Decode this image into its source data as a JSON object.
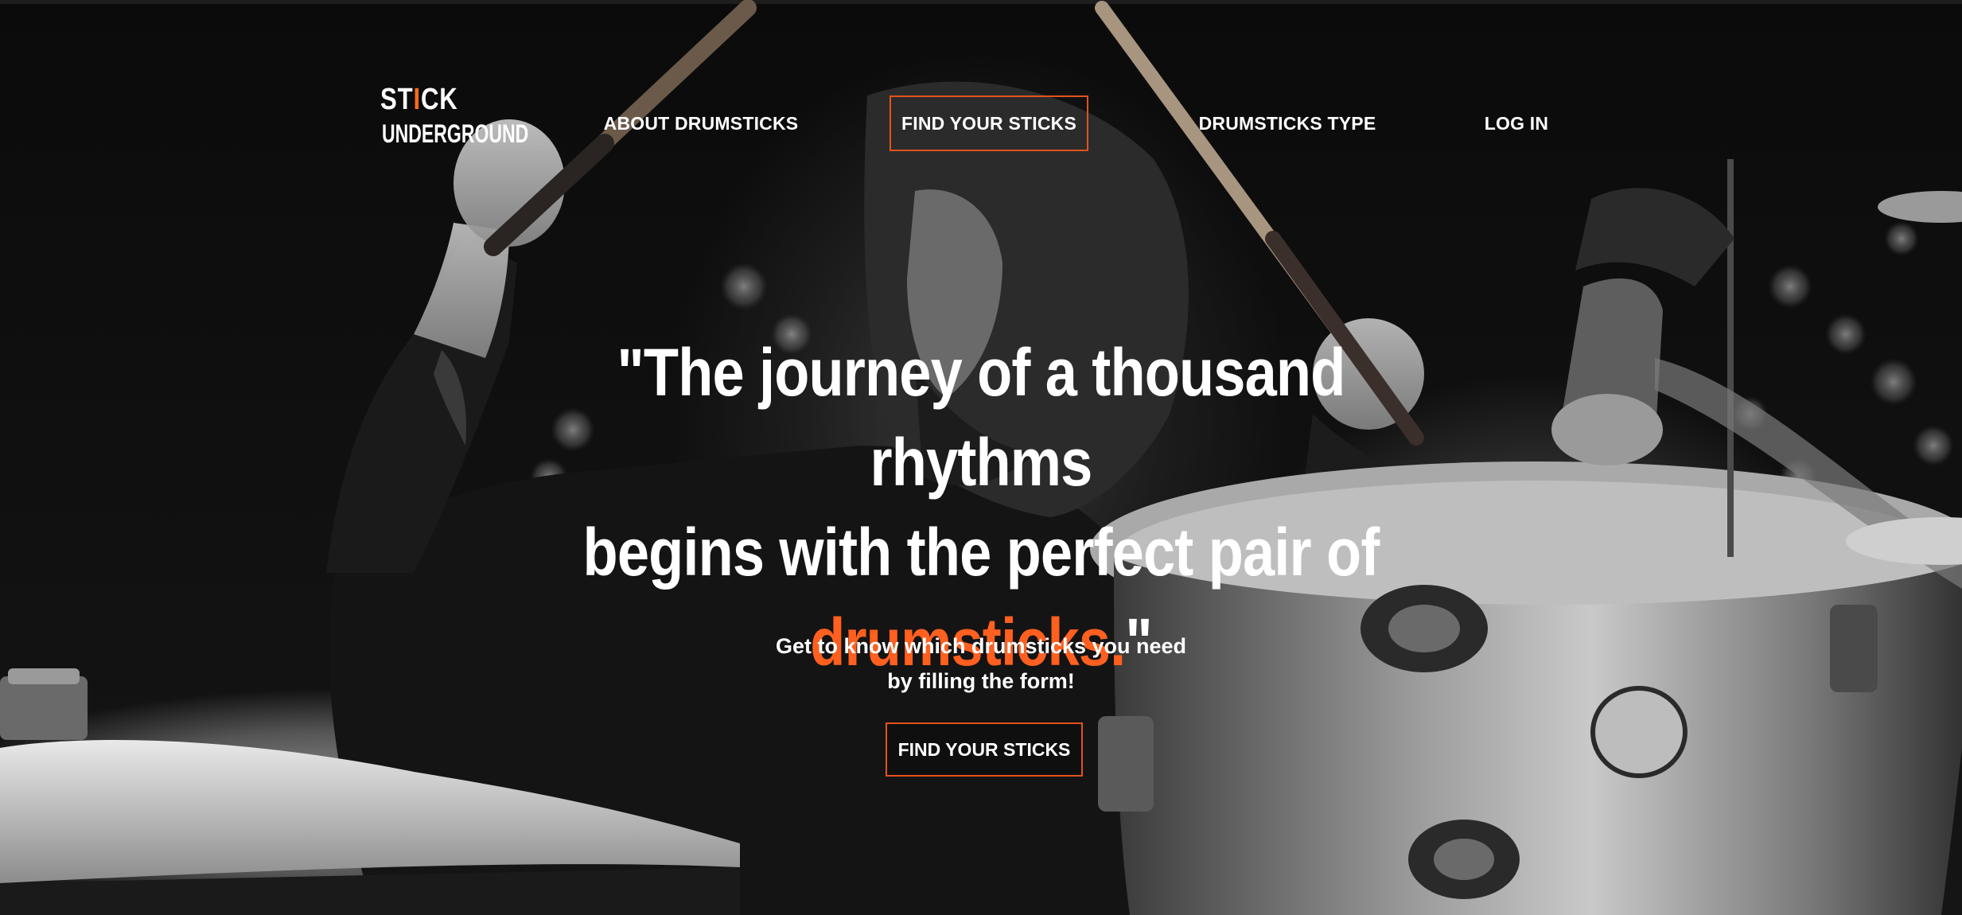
{
  "brand": {
    "line1_before": "ST",
    "line1_accent": "I",
    "line1_after": "CK",
    "line2": "UNDERGROUND"
  },
  "nav": {
    "about": "ABOUT DRUMSTICKS",
    "find": "FIND YOUR STICKS",
    "type": "DRUMSTICKS TYPE",
    "login": "LOG IN"
  },
  "hero": {
    "quote_line1": "\"The journey of a thousand rhythms",
    "quote_line2": "begins with the perfect pair of",
    "quote_accent": "drumsticks.",
    "quote_end": "\"",
    "subtitle_line1": "Get to know which drumsticks you need",
    "subtitle_line2": "by filling the form!",
    "cta_label": "FIND YOUR STICKS"
  },
  "colors": {
    "accent": "#ff5f1f",
    "border_accent": "#e2531d",
    "text": "#ffffff",
    "background": "#000000"
  },
  "icons": {
    "logo_stick": "drumstick-icon"
  }
}
